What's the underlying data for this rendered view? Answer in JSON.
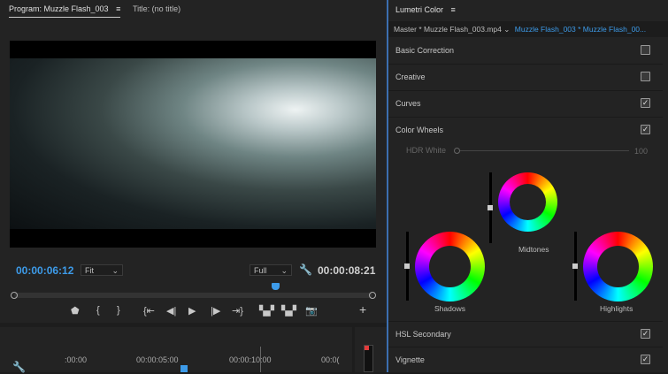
{
  "program": {
    "tab_label": "Program: Muzzle Flash_003",
    "title_tab": "Title: (no title)",
    "timecode": "00:00:06:12",
    "zoom": "Fit",
    "quality": "Full",
    "duration": "00:00:08:21",
    "playhead_fraction": 0.74
  },
  "controls": [
    "marker-icon",
    "mark-in-icon",
    "mark-out-icon",
    "go-to-in-icon",
    "step-back-icon",
    "play-icon",
    "step-forward-icon",
    "go-to-out-icon",
    "insert-icon",
    "overwrite-icon",
    "export-frame-icon",
    "add-button-icon"
  ],
  "timeline": {
    "ruler": [
      ":00:00",
      "00:00:05:00",
      "00:00:10:00",
      "00:0("
    ]
  },
  "lumetri": {
    "title": "Lumetri Color",
    "master": "Master * Muzzle Flash_003.mp4",
    "clip": "Muzzle Flash_003 * Muzzle Flash_00...",
    "sections": [
      {
        "label": "Basic Correction",
        "checked": false
      },
      {
        "label": "Creative",
        "checked": false
      },
      {
        "label": "Curves",
        "checked": true
      },
      {
        "label": "Color Wheels",
        "checked": true
      }
    ],
    "hdr_label": "HDR White",
    "hdr_value": "100",
    "wheels": {
      "midtones": "Midtones",
      "shadows": "Shadows",
      "highlights": "Highlights"
    },
    "lower": [
      {
        "label": "HSL Secondary",
        "checked": true
      },
      {
        "label": "Vignette",
        "checked": true
      }
    ]
  },
  "colors": {
    "accent": "#3d9be9"
  }
}
